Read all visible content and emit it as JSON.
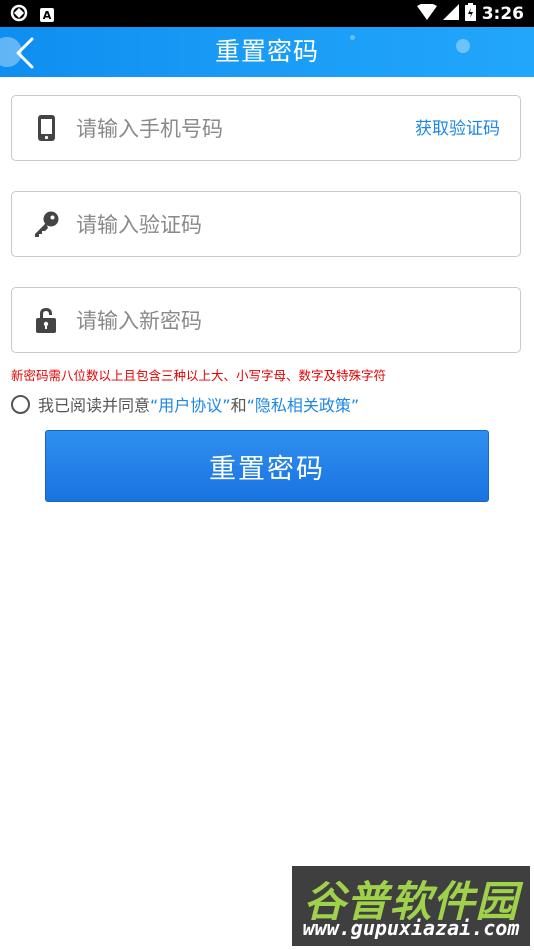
{
  "status_bar": {
    "time": "3:26",
    "a_badge": "A",
    "icons": [
      "sync-icon",
      "notification-a-icon",
      "wifi-icon",
      "signal-icon",
      "battery-icon"
    ]
  },
  "header": {
    "title": "重置密码",
    "back_icon": "chevron-left-icon",
    "color": "#1a9cf6"
  },
  "form": {
    "phone": {
      "placeholder": "请输入手机号码",
      "value": "",
      "icon": "phone-icon"
    },
    "get_code_label": "获取验证码",
    "code": {
      "placeholder": "请输入验证码",
      "value": "",
      "icon": "key-icon"
    },
    "password": {
      "placeholder": "请输入新密码",
      "value": "",
      "icon": "lock-icon"
    },
    "hint": "新密码需八位数以上且包含三种以上大、小写字母、数字及特殊字符",
    "agreement": {
      "prefix": "我已阅读并同意",
      "link1": "“用户协议”",
      "and": "和",
      "link2": "“隐私相关政策”",
      "checked": false
    },
    "submit_label": "重置密码"
  },
  "watermark": {
    "title": "谷普软件园",
    "url": "www.gupuxiazai.com"
  },
  "colors": {
    "accent": "#1b87e6",
    "hint": "#e60000",
    "button": "#1a73e0"
  }
}
